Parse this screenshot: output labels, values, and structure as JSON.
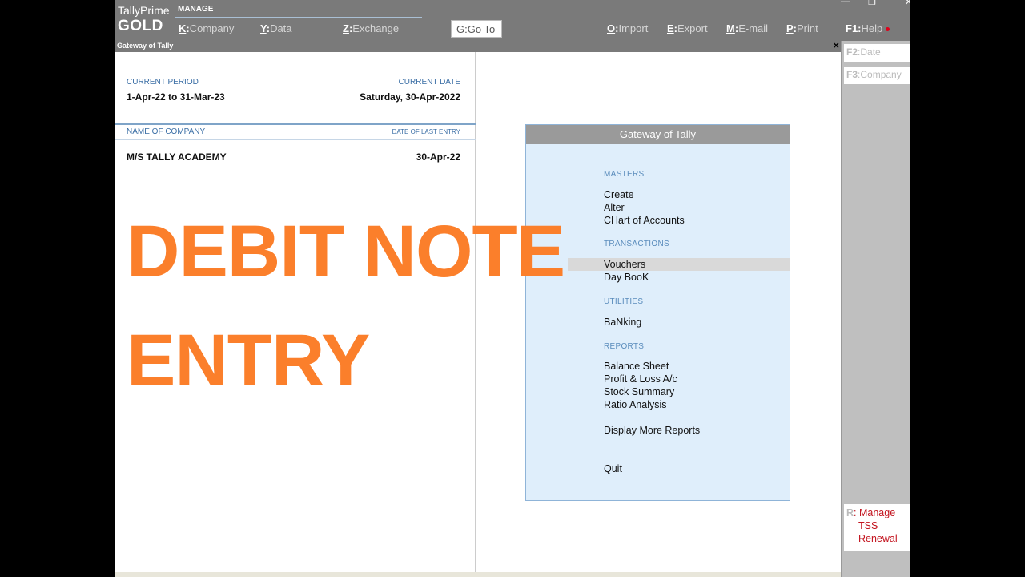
{
  "brand": {
    "name": "TallyPrime",
    "edition": "GOLD",
    "manage": "MANAGE"
  },
  "menu": [
    {
      "key": "K",
      "label": "Company"
    },
    {
      "key": "Y",
      "label": "Data"
    },
    {
      "key": "Z",
      "label": "Exchange"
    },
    {
      "key": "G",
      "label": "Go To"
    },
    {
      "key": "O",
      "label": "Import"
    },
    {
      "key": "E",
      "label": "Export"
    },
    {
      "key": "M",
      "label": "E-mail"
    },
    {
      "key": "P",
      "label": "Print"
    },
    {
      "key": "F1",
      "label": "Help"
    }
  ],
  "window": {
    "title": "Gateway of Tally",
    "close": "×"
  },
  "period": {
    "current_period_label": "CURRENT PERIOD",
    "current_period_value": "1-Apr-22 to 31-Mar-23",
    "current_date_label": "CURRENT DATE",
    "current_date_value": "Saturday, 30-Apr-2022"
  },
  "company": {
    "name_label": "NAME OF COMPANY",
    "last_entry_label": "DATE OF LAST ENTRY",
    "name": "M/S TALLY ACADEMY",
    "last_entry": "30-Apr-22"
  },
  "overlay": {
    "line1": "DEBIT NOTE",
    "line2": "ENTRY"
  },
  "gateway": {
    "title": "Gateway of Tally",
    "masters_label": "MASTERS",
    "transactions_label": "TRANSACTIONS",
    "utilities_label": "UTILITIES",
    "reports_label": "REPORTS",
    "create": "Create",
    "alter": "Alter",
    "chart": "CHart of Accounts",
    "vouchers": "Vouchers",
    "daybook": "Day BooK",
    "banking": "BaNking",
    "balance_sheet": "Balance Sheet",
    "profit_loss": "Profit & Loss A/c",
    "stock_summary": "Stock Summary",
    "ratio_analysis": "Ratio Analysis",
    "display_more": "Display More Reports",
    "quit": "Quit"
  },
  "side": {
    "date_key": "F2",
    "date_label": "Date",
    "company_key": "F3",
    "company_label": "Company",
    "tss_key": "R",
    "tss_line1": "Manage",
    "tss_line2": "TSS",
    "tss_line3": "Renewal"
  }
}
